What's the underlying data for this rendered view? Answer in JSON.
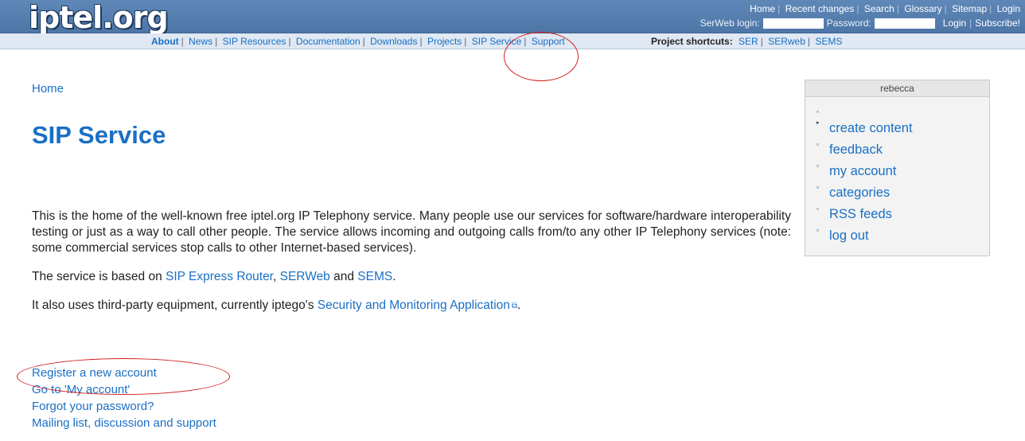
{
  "header": {
    "logo": "iptel.org",
    "top_links": [
      "Home",
      "Recent changes",
      "Search",
      "Glossary",
      "Sitemap",
      "Login"
    ],
    "login": {
      "serweb_label": "SerWeb login:",
      "password_label": "Password:",
      "login_button": "Login",
      "subscribe_link": "Subscribe!"
    }
  },
  "nav": {
    "items": [
      "About",
      "News",
      "SIP Resources",
      "Documentation",
      "Downloads",
      "Projects",
      "SIP Service",
      "Support"
    ],
    "shortcuts_label": "Project shortcuts:",
    "shortcuts": [
      "SER",
      "SERweb",
      "SEMS"
    ]
  },
  "breadcrumb": "Home",
  "page_title": "SIP Service",
  "content": {
    "para1": "This is the home of the well-known free iptel.org IP Telephony service. Many people use our services for software/hardware interoperability testing or just as a way to call other people. The service allows incoming and outgoing calls from/to any other IP Telephony services (note: some commercial services stop calls to other Internet-based services).",
    "para2_prefix": "The service is based on ",
    "para2_link1": "SIP Express Router",
    "para2_sep": ", ",
    "para2_link2": "SERWeb",
    "para2_and": " and ",
    "para2_link3": "SEMS",
    "para2_suffix": ".",
    "para3_prefix": "It also uses third-party equipment, currently iptego's ",
    "para3_link": "Security and Monitoring Application",
    "para3_suffix": ".",
    "links": [
      "Register a new account",
      "Go to 'My account'",
      "Forgot your password?",
      "Mailing list, discussion and support"
    ]
  },
  "sidebar": {
    "user": "rebecca",
    "items": [
      "create content",
      "feedback",
      "my account",
      "categories",
      "RSS feeds",
      "log out"
    ]
  },
  "annotation_color": "#d21c1c"
}
